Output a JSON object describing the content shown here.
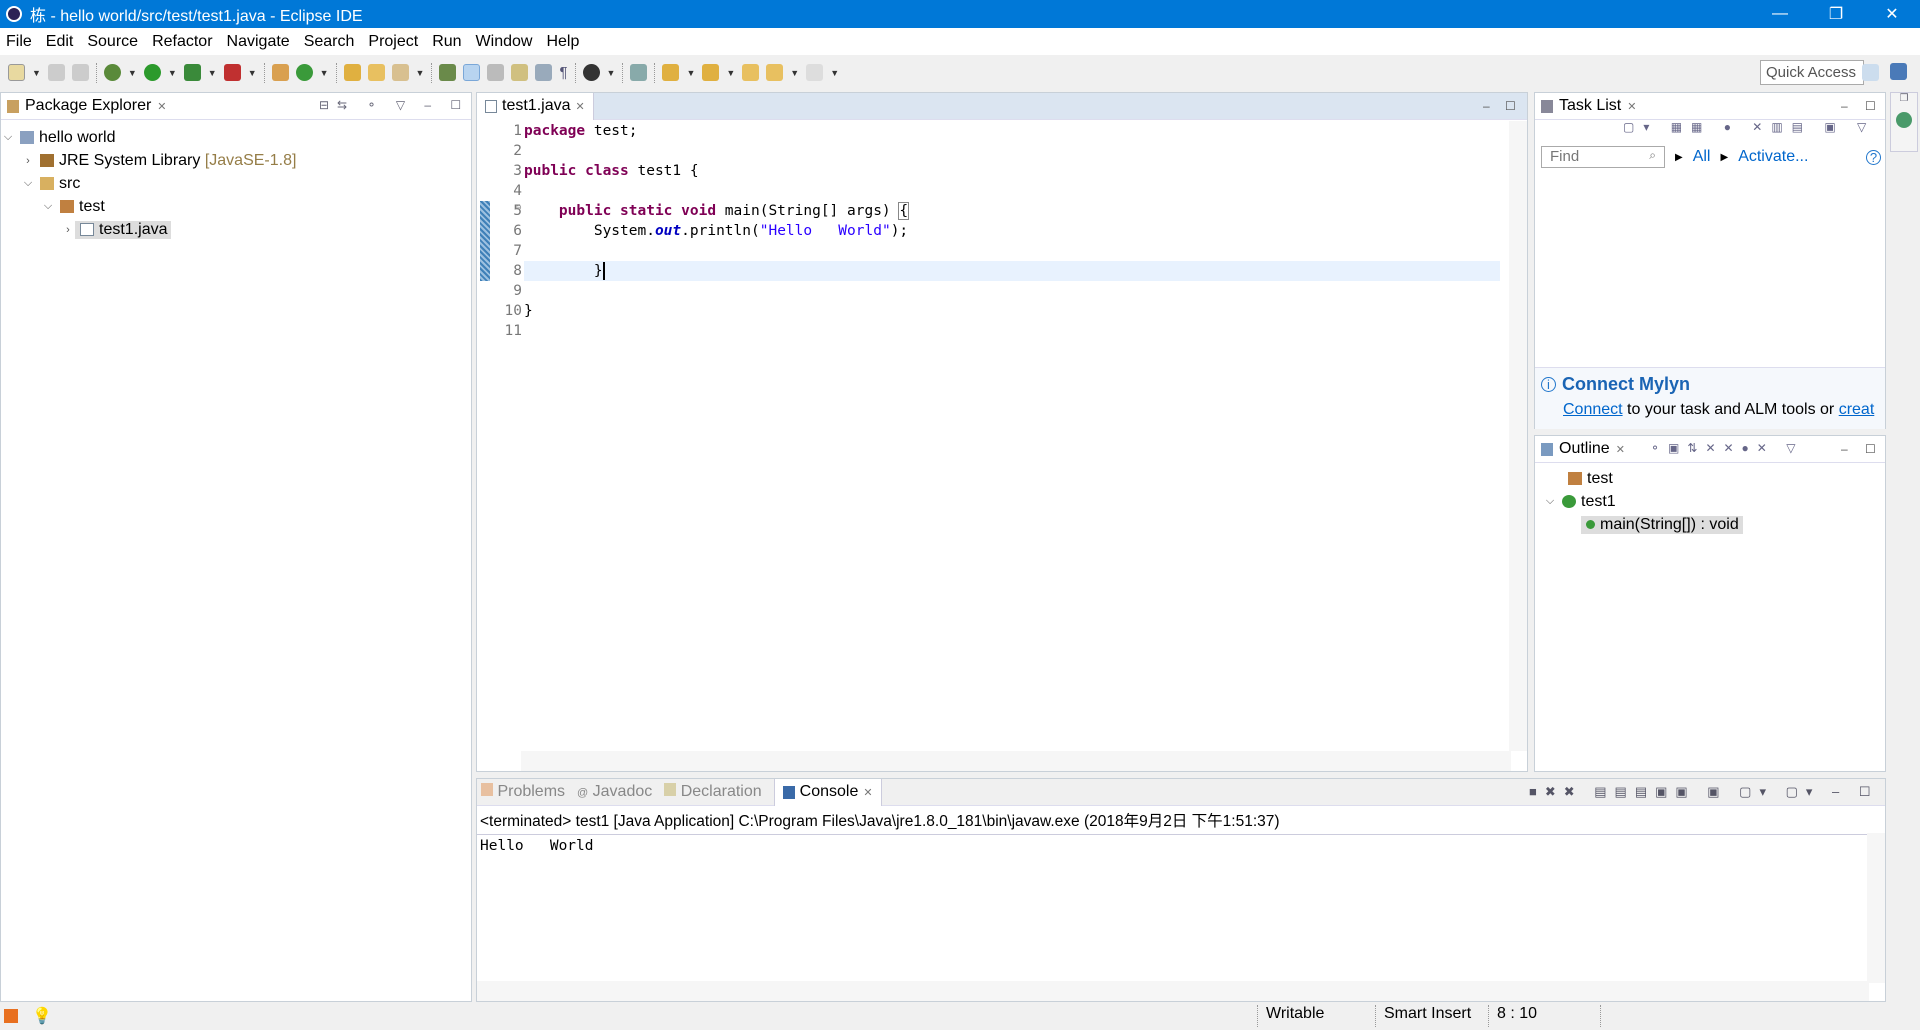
{
  "window": {
    "title": "栋 - hello world/src/test/test1.java - Eclipse IDE",
    "minimize": "—",
    "restore": "❐",
    "close": "✕"
  },
  "menu": [
    "File",
    "Edit",
    "Source",
    "Refactor",
    "Navigate",
    "Search",
    "Project",
    "Run",
    "Window",
    "Help"
  ],
  "toolbar": {
    "quick_access": "Quick Access"
  },
  "package_explorer": {
    "title": "Package Explorer",
    "tree": [
      {
        "label": "hello world",
        "icon": "project-icon",
        "expanded": true
      },
      {
        "label": "JRE System Library",
        "suffix": "[JavaSE-1.8]",
        "icon": "library-icon"
      },
      {
        "label": "src",
        "icon": "source-folder-icon",
        "expanded": true
      },
      {
        "label": "test",
        "icon": "package-icon",
        "expanded": true
      },
      {
        "label": "test1.java",
        "icon": "java-file-icon",
        "selected": true
      }
    ]
  },
  "editor": {
    "tab": "test1.java",
    "line_numbers": [
      "1",
      "2",
      "3",
      "4",
      "5",
      "6",
      "7",
      "8",
      "9",
      "10",
      "11"
    ],
    "cursor_line": 8
  },
  "task_list": {
    "title": "Task List",
    "find_placeholder": "Find",
    "all": "All",
    "activate": "Activate...",
    "mylyn_title": "Connect Mylyn",
    "mylyn_link": "Connect",
    "mylyn_text": " to your task and ALM tools or ",
    "mylyn_link2": "creat"
  },
  "outline": {
    "title": "Outline",
    "items": [
      {
        "label": "test",
        "icon": "package-icon"
      },
      {
        "label": "test1",
        "icon": "class-icon"
      },
      {
        "label": "main(String[]) : void",
        "icon": "method-icon",
        "selected": true
      }
    ]
  },
  "bottom": {
    "tabs": [
      "Problems",
      "Javadoc",
      "Declaration",
      "Console"
    ],
    "active": "Console",
    "terminated": "<terminated> test1 [Java Application] C:\\Program Files\\Java\\jre1.8.0_181\\bin\\javaw.exe (2018年9月2日 下午1:51:37)",
    "output": "Hello   World"
  },
  "status": {
    "writable": "Writable",
    "insert": "Smart Insert",
    "position": "8 : 10"
  },
  "colors": {
    "titlebar": "#0078d7",
    "keyword": "#7f0055",
    "string": "#2a00ff",
    "field": "#0000c0",
    "link": "#0066cc"
  }
}
